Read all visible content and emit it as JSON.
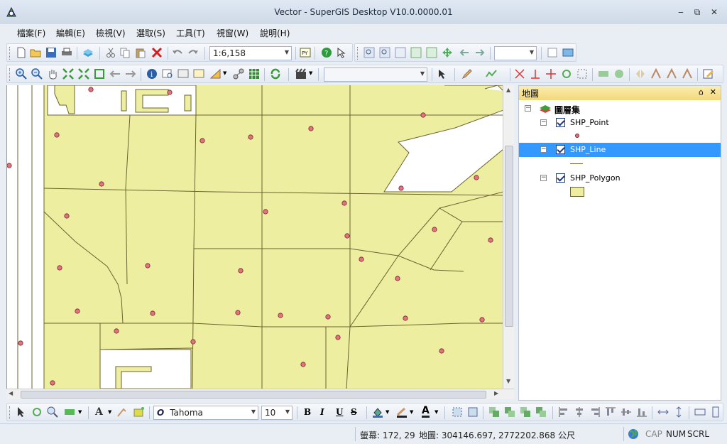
{
  "window": {
    "title": "Vector - SuperGIS Desktop V10.0.0000.01",
    "minimize": "‒",
    "restore": "⧉",
    "close": "✕"
  },
  "menu": [
    {
      "label": "檔案(F)"
    },
    {
      "label": "編輯(E)"
    },
    {
      "label": "檢視(V)"
    },
    {
      "label": "選取(S)"
    },
    {
      "label": "工具(T)"
    },
    {
      "label": "視窗(W)"
    },
    {
      "label": "說明(H)"
    }
  ],
  "toolbar": {
    "scale": "1:6,158",
    "layer_combo": "",
    "font_name": "Tahoma",
    "font_size": "10",
    "bold": "B",
    "italic": "I",
    "underline": "U",
    "strike": "S"
  },
  "panel": {
    "title": "地圖",
    "pin": "⌂",
    "close": "✕",
    "root_label": "圖層集",
    "layers": [
      {
        "name": "SHP_Point",
        "checked": true,
        "selected": false
      },
      {
        "name": "SHP_Line",
        "checked": true,
        "selected": true
      },
      {
        "name": "SHP_Polygon",
        "checked": true,
        "selected": false
      }
    ]
  },
  "status": {
    "screen_label": "螢幕: 172, 29",
    "map_label": "地圖: 304146.697, 2772202.868 公尺",
    "caps": "CAP",
    "num": "NUM",
    "scrl": "SCRL"
  },
  "colors": {
    "polygon_fill": "#eeeea0",
    "polygon_edge": "#6b6232",
    "point_fill": "#e8707e",
    "point_edge": "#6a2a30",
    "selection": "#3399ff",
    "panel_header": "#f3d77a"
  },
  "icons": [
    "new-file-icon",
    "open-folder-icon",
    "save-icon",
    "print-icon",
    "add-layer-icon",
    "cut-icon",
    "copy-icon",
    "paste-icon",
    "delete-icon",
    "undo-icon",
    "redo-icon",
    "python-icon",
    "help-icon",
    "whats-this-icon",
    "zoom-in-icon",
    "zoom-out-icon",
    "pan-icon",
    "full-extent-icon",
    "identify-icon",
    "refresh-icon",
    "select-arrow-icon",
    "font-icon"
  ]
}
